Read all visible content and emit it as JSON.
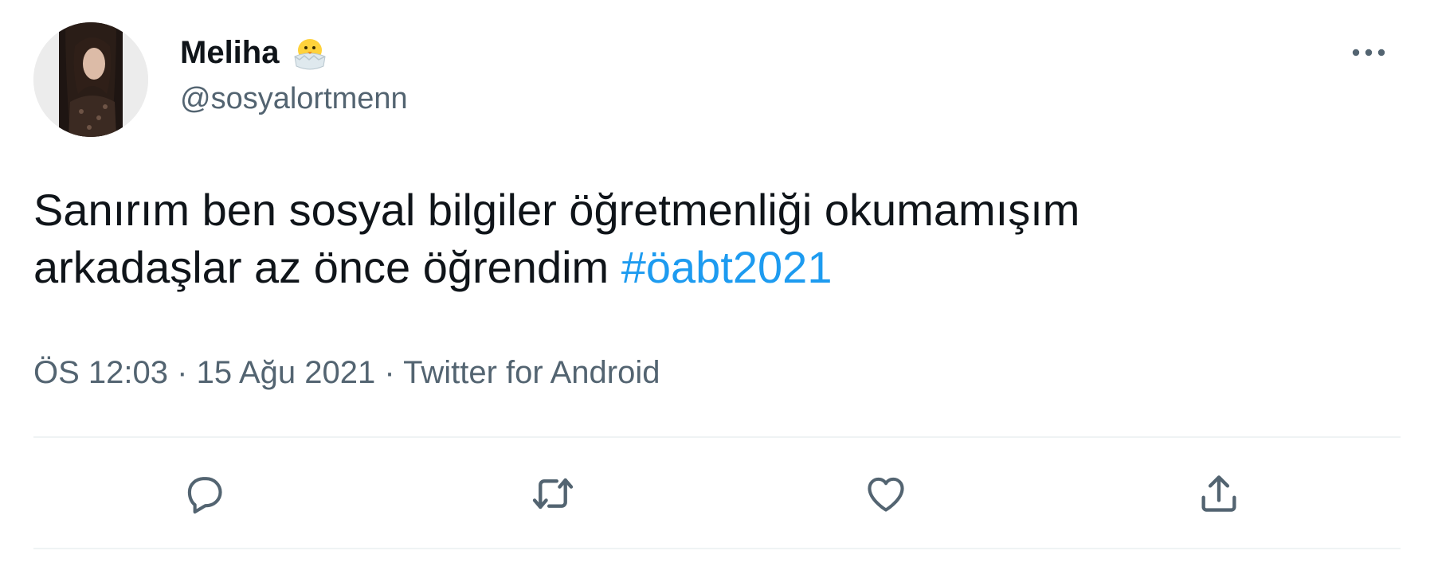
{
  "user": {
    "display_name": "Meliha",
    "handle": "@sosyalortmenn",
    "emoji_icon": "hatching-chick-icon"
  },
  "tweet": {
    "text_line1": "Sanırım ben sosyal bilgiler öğretmenliği okumamışım",
    "text_line2": "arkadaşlar az önce öğrendim",
    "hashtag": "#öabt2021"
  },
  "meta": {
    "time": "ÖS 12:03",
    "separator": "·",
    "date": "15 Ağu 2021",
    "source": "Twitter for Android"
  },
  "actions": [
    {
      "icon": "reply-icon"
    },
    {
      "icon": "retweet-icon"
    },
    {
      "icon": "like-icon"
    },
    {
      "icon": "share-icon"
    }
  ],
  "colors": {
    "text": "#0f1419",
    "secondary": "#536471",
    "link": "#1d9bf0",
    "divider": "#eff3f4"
  }
}
